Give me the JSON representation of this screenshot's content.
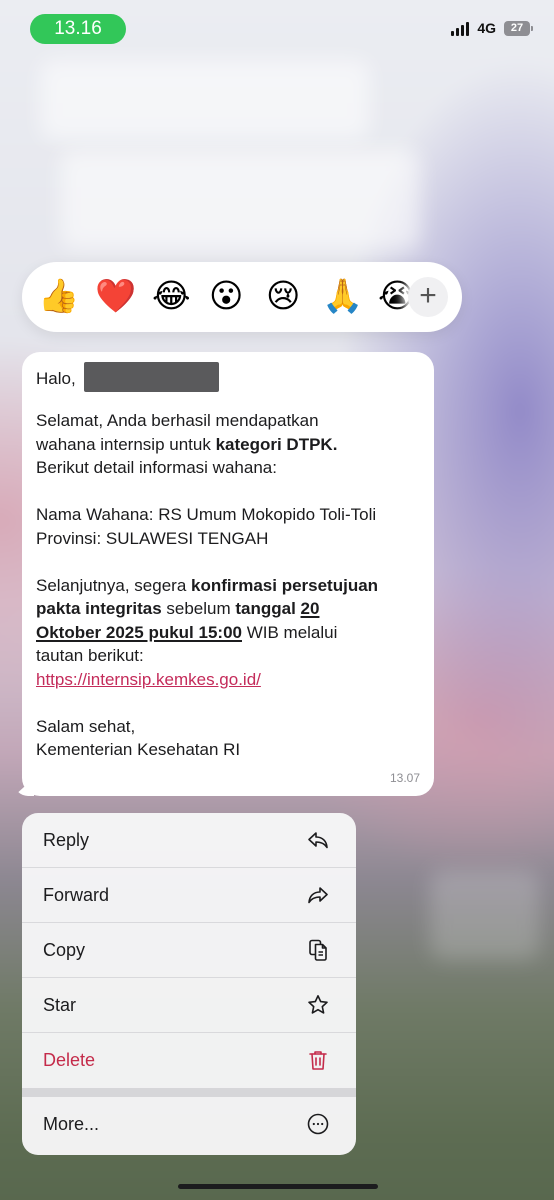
{
  "status_bar": {
    "time": "13.16",
    "network": "4G",
    "battery": "27"
  },
  "reactions": {
    "emojis": [
      "👍",
      "❤️",
      "😂",
      "😮",
      "😢",
      "🙏",
      "😭"
    ],
    "more_icon": "plus-icon"
  },
  "message": {
    "greeting": "Halo,",
    "para1_line1": "Selamat, Anda berhasil mendapatkan",
    "para1_line2_pre": "wahana internsip untuk ",
    "para1_line2_bold": "kategori DTPK.",
    "para1_line3": "Berikut detail informasi wahana:",
    "detail_line1": "Nama Wahana: RS Umum Mokopido Toli-Toli",
    "detail_line2": "Provinsi: SULAWESI TENGAH",
    "para3_line1_pre": "Selanjutnya, segera ",
    "para3_line1_bold": "konfirmasi persetujuan",
    "para3_line2_bold": "pakta integritas",
    "para3_line2_mid": " sebelum ",
    "para3_line2_bold2": "tanggal ",
    "para3_line2_ul": "20",
    "para3_line3_ul": "Oktober 2025 pukul 15:00",
    "para3_line3_post": " WIB melalui",
    "para3_line4": "tautan berikut:",
    "link": "https://internsip.kemkes.go.id/",
    "closing_line1": "Salam sehat,",
    "closing_line2": "Kementerian Kesehatan RI",
    "time": "13.07"
  },
  "menu": {
    "reply": "Reply",
    "forward": "Forward",
    "copy": "Copy",
    "star": "Star",
    "delete": "Delete",
    "more": "More...",
    "colors": {
      "danger": "#c42b4a",
      "link": "#c42b5a",
      "time_badge": "#32c759"
    }
  }
}
